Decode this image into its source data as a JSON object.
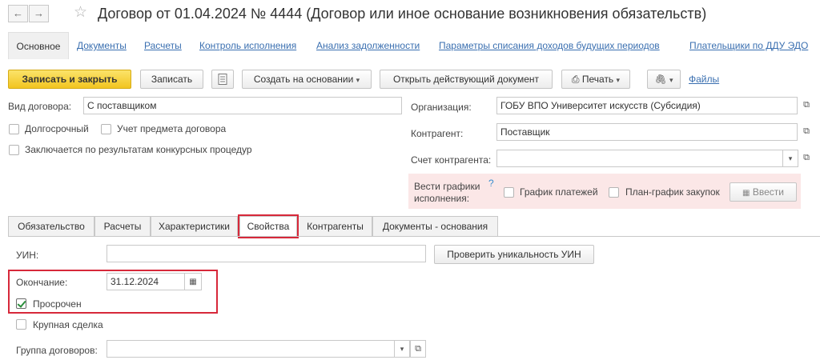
{
  "window": {
    "title": "Договор от 01.04.2024 № 4444 (Договор или иное основание возникновения обязательств)"
  },
  "nav": {
    "back_icon": "arrow-left-icon",
    "forward_icon": "arrow-right-icon",
    "favorite_icon": "star-icon"
  },
  "top_tabs": [
    {
      "label": "Основное"
    },
    {
      "label": "Документы"
    },
    {
      "label": "Расчеты"
    },
    {
      "label": "Контроль исполнения"
    },
    {
      "label": "Анализ задолженности"
    },
    {
      "label": "Параметры списания доходов будущих периодов"
    },
    {
      "label": "Плательщики по ДДУ ЭДО"
    }
  ],
  "toolbar": {
    "save_close": "Записать и закрыть",
    "save": "Записать",
    "create_based": "Создать на основании",
    "open_current": "Открыть действующий документ",
    "print": "Печать",
    "files": "Файлы",
    "dropdown_glyph": "▾",
    "icons": [
      "document-icon",
      "printer-icon",
      "paperclip-icon"
    ]
  },
  "left": {
    "contract_type_label": "Вид договора:",
    "contract_type_value": "С поставщиком",
    "long_term": "Долгосрочный",
    "subject_accounting": "Учет предмета договора",
    "tender_based": "Заключается по результатам конкурсных процедур"
  },
  "right": {
    "org_label": "Организация:",
    "org_value": "ГОБУ ВПО Университет искусств (Субсидия)",
    "counterparty_label": "Контрагент:",
    "counterparty_value": "Поставщик",
    "account_label": "Счет контрагента:",
    "account_value": "",
    "schedules_label_1": "Вести графики",
    "schedules_label_2": "исполнения:",
    "help": "?",
    "payment_schedule": "График платежей",
    "purchase_plan": "План-график закупок",
    "apply": "Ввести"
  },
  "tabs": [
    {
      "label": "Обязательство",
      "active": false
    },
    {
      "label": "Расчеты",
      "active": false
    },
    {
      "label": "Характеристики",
      "active": false
    },
    {
      "label": "Свойства",
      "active": true
    },
    {
      "label": "Контрагенты",
      "active": false
    },
    {
      "label": "Документы - основания",
      "active": false
    }
  ],
  "properties": {
    "uin_label": "УИН:",
    "uin_value": "",
    "check_uin": "Проверить уникальность УИН",
    "end_label": "Окончание:",
    "end_value": "31.12.2024",
    "overdue": "Просрочен",
    "overdue_checked": true,
    "major_deal": "Крупная сделка",
    "major_deal_checked": false,
    "group_label": "Группа договоров:",
    "group_value": ""
  },
  "colors": {
    "accent_link": "#3a6fb0",
    "primary_button": "#f2c520",
    "highlight_box": "#d7283a",
    "schedule_panel_bg": "#fbe7e7"
  }
}
